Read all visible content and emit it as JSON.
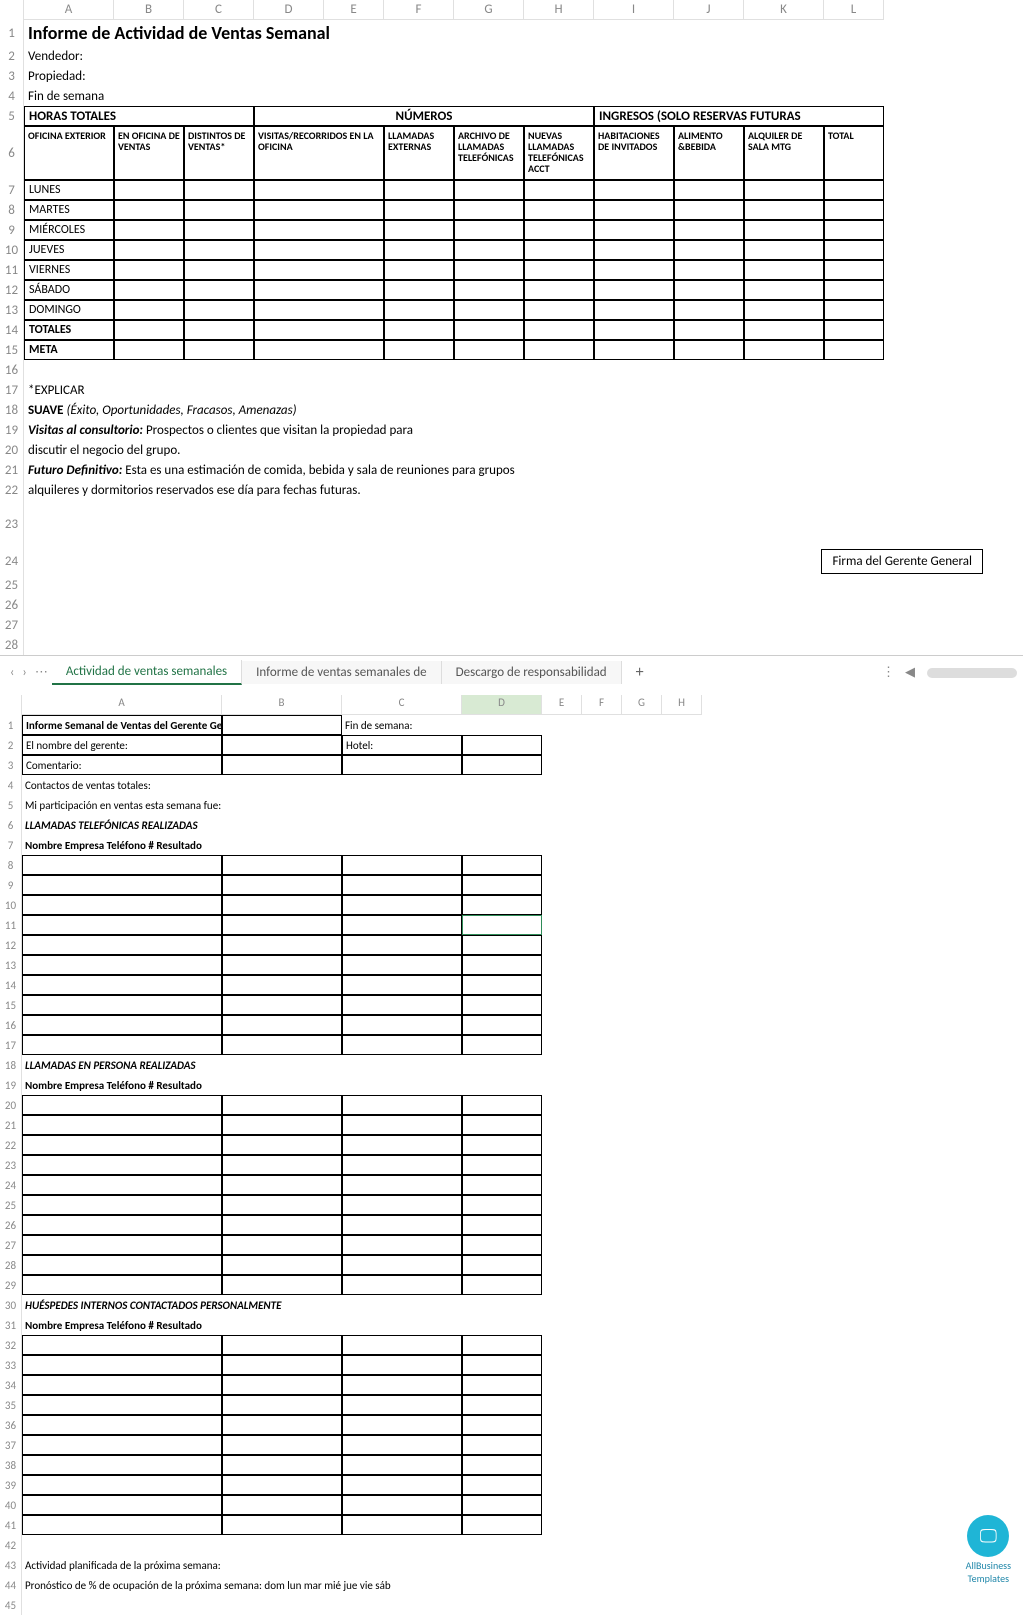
{
  "sheet1": {
    "colLetters": [
      "A",
      "B",
      "C",
      "D",
      "E",
      "F",
      "G",
      "H",
      "I",
      "J",
      "K",
      "L"
    ],
    "title": "Informe de Actividad de Ventas Semanal",
    "meta": {
      "vendedor": "Vendedor:",
      "propiedad": "Propiedad:",
      "finsemana": "Fin de semana"
    },
    "section_headers": {
      "horas": "HORAS TOTALES",
      "numeros": "NÚMEROS",
      "ingresos": "INGRESOS (SOLO RESERVAS FUTURAS"
    },
    "col_headers": [
      "OFICINA EXTERIOR",
      "EN OFICINA DE VENTAS",
      "DISTINTOS DE VENTAS*",
      "VISITAS/RECORRIDOS EN LA OFICINA",
      "LLAMADAS EXTERNAS",
      "ARCHIVO DE LLAMADAS TELEFÓNICAS",
      "NUEVAS LLAMADAS TELEFÓNICAS ACCT",
      "HABITACIONES DE INVITADOS",
      "ALIMENTO &BEBIDA",
      "ALQUILER DE SALA MTG",
      "TOTAL"
    ],
    "days": [
      "LUNES",
      "MARTES",
      "MIÉRCOLES",
      "JUEVES",
      "VIERNES",
      "SÁBADO",
      "DOMINGO"
    ],
    "totales": "TOTALES",
    "meta_row": "META",
    "notes": {
      "explicar": "*EXPLICAR",
      "suave_label": "SUAVE",
      "suave_paren": "(Éxito, Oportunidades, Fracasos, Amenazas)",
      "visitas_label": "Visitas al consultorio:",
      "visitas_text1": "Prospectos o clientes que visitan la propiedad para",
      "visitas_text2": "discutir el negocio del grupo.",
      "futuro_label": "Futuro Definitivo:",
      "futuro_text1": "Esta es una estimación de comida, bebida y sala de reuniones para grupos",
      "futuro_text2": "alquileres y dormitorios reservados ese día para fechas futuras."
    },
    "signature": "Firma del Gerente General"
  },
  "tabs": {
    "active": "Actividad de ventas semanales",
    "t2": "Informe de ventas semanales de",
    "t3": "Descargo de responsabilidad"
  },
  "sheet2": {
    "colLetters": [
      "A",
      "B",
      "C",
      "D",
      "E",
      "F",
      "G",
      "H"
    ],
    "r1a": "Informe Semanal de Ventas del Gerente General",
    "r1c": "Fin de semana:",
    "r2a": "El nombre del gerente:",
    "r2c": "Hotel:",
    "r3a": "Comentario:",
    "r4a": "Contactos de ventas totales:",
    "r5a": "Mi participación en ventas esta semana fue:",
    "r6a": "LLAMADAS TELEFÓNICAS REALIZADAS",
    "r7a": "Nombre Empresa Teléfono # Resultado",
    "r18a": "LLAMADAS EN PERSONA REALIZADAS",
    "r19a": "Nombre Empresa Teléfono # Resultado",
    "r30a": "HUÉSPEDES INTERNOS CONTACTADOS PERSONALMENTE",
    "r31a": "Nombre Empresa Teléfono # Resultado",
    "r43a": "Actividad planificada de la próxima semana:",
    "r44a": "Pronóstico de % de ocupación de la próxima semana: dom lun mar mié jue vie sáb"
  },
  "badge": {
    "brand": "AllBusiness",
    "brand2": "Templates",
    "icon": "🖵"
  }
}
